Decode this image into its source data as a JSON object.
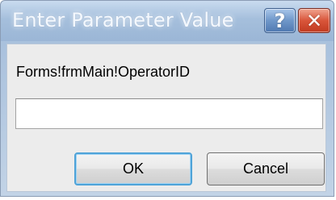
{
  "window": {
    "title": "Enter Parameter Value",
    "help_glyph": "?",
    "close_glyph": "✕"
  },
  "prompt": {
    "label": "Forms!frmMain!OperatorID"
  },
  "input": {
    "value": "",
    "placeholder": ""
  },
  "buttons": {
    "ok_label": "OK",
    "cancel_label": "Cancel"
  },
  "icons": {
    "help": "help-icon",
    "close": "close-icon"
  },
  "colors": {
    "titlebar": "#a5bfdc",
    "close_button": "#d9553a",
    "help_button": "#6f97c9",
    "default_button_focus": "#4fa3d8"
  }
}
